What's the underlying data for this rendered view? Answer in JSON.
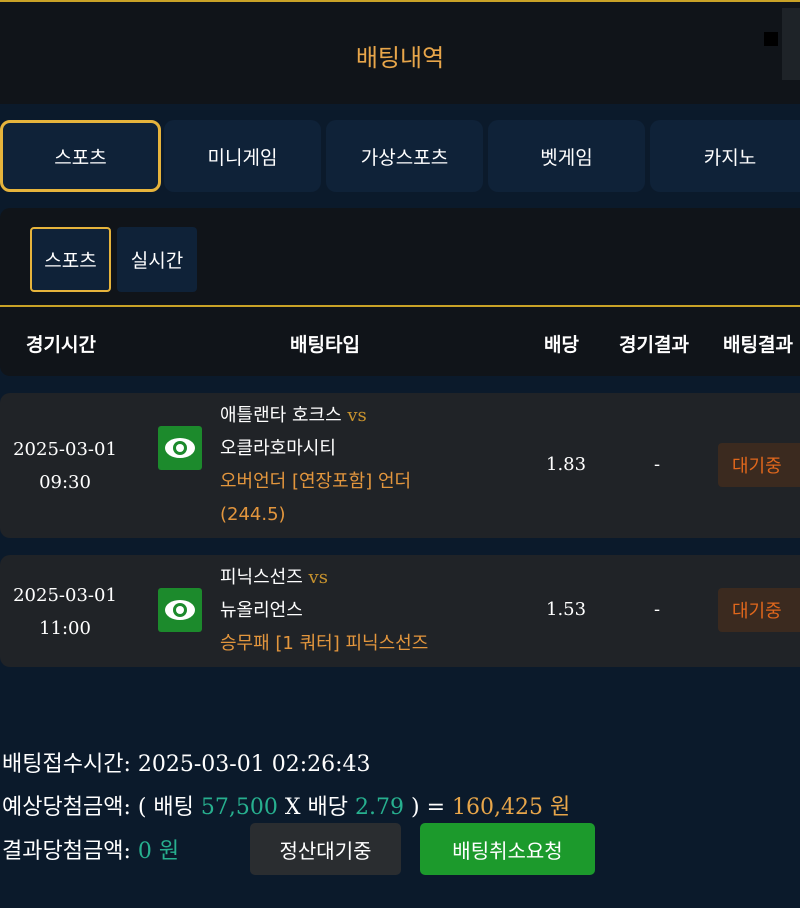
{
  "header": {
    "title": "배팅내역"
  },
  "tabs": [
    {
      "label": "스포츠",
      "active": true
    },
    {
      "label": "미니게임",
      "active": false
    },
    {
      "label": "가상스포츠",
      "active": false
    },
    {
      "label": "벳게임",
      "active": false
    },
    {
      "label": "카지노",
      "active": false
    }
  ],
  "subtabs": [
    {
      "label": "스포츠",
      "active": true
    },
    {
      "label": "실시간",
      "active": false
    }
  ],
  "columns": {
    "time": "경기시간",
    "type": "배팅타입",
    "odds": "배당",
    "match_result": "경기결과",
    "bet_result": "배팅결과"
  },
  "bets": [
    {
      "date": "2025-03-01",
      "time": "09:30",
      "home": "애틀랜타 호크스",
      "vs": "vs",
      "away": "오클라호마시티",
      "pick_line1": "오버언더 [연장포함] 언더",
      "pick_line2": "(244.5)",
      "odds": "1.83",
      "result": "-",
      "status": "대기중"
    },
    {
      "date": "2025-03-01",
      "time": "11:00",
      "home": "피닉스선즈",
      "vs": "vs",
      "away": "뉴올리언스",
      "pick_line1": "승무패 [1 쿼터] 피닉스선즈",
      "odds": "1.53",
      "result": "-",
      "status": "대기중"
    }
  ],
  "summary": {
    "received_label": "배팅접수시간:",
    "received_time": "2025-03-01 02:26:43",
    "expected_label": "예상당첨금액:",
    "open_paren": "( 배팅",
    "stake": "57,500",
    "times_label": "X 배당",
    "total_odds": "2.79",
    "close_paren": ") =",
    "expected_amount": "160,425 원",
    "result_label": "결과당첨금액:",
    "result_amount": "0 원"
  },
  "buttons": {
    "settle_pending": "정산대기중",
    "cancel_request": "배팅취소요청"
  },
  "colors": {
    "accent_gold": "#e6b43c",
    "win_green": "#27b08f",
    "cancel_button": "#1c9a2c"
  }
}
